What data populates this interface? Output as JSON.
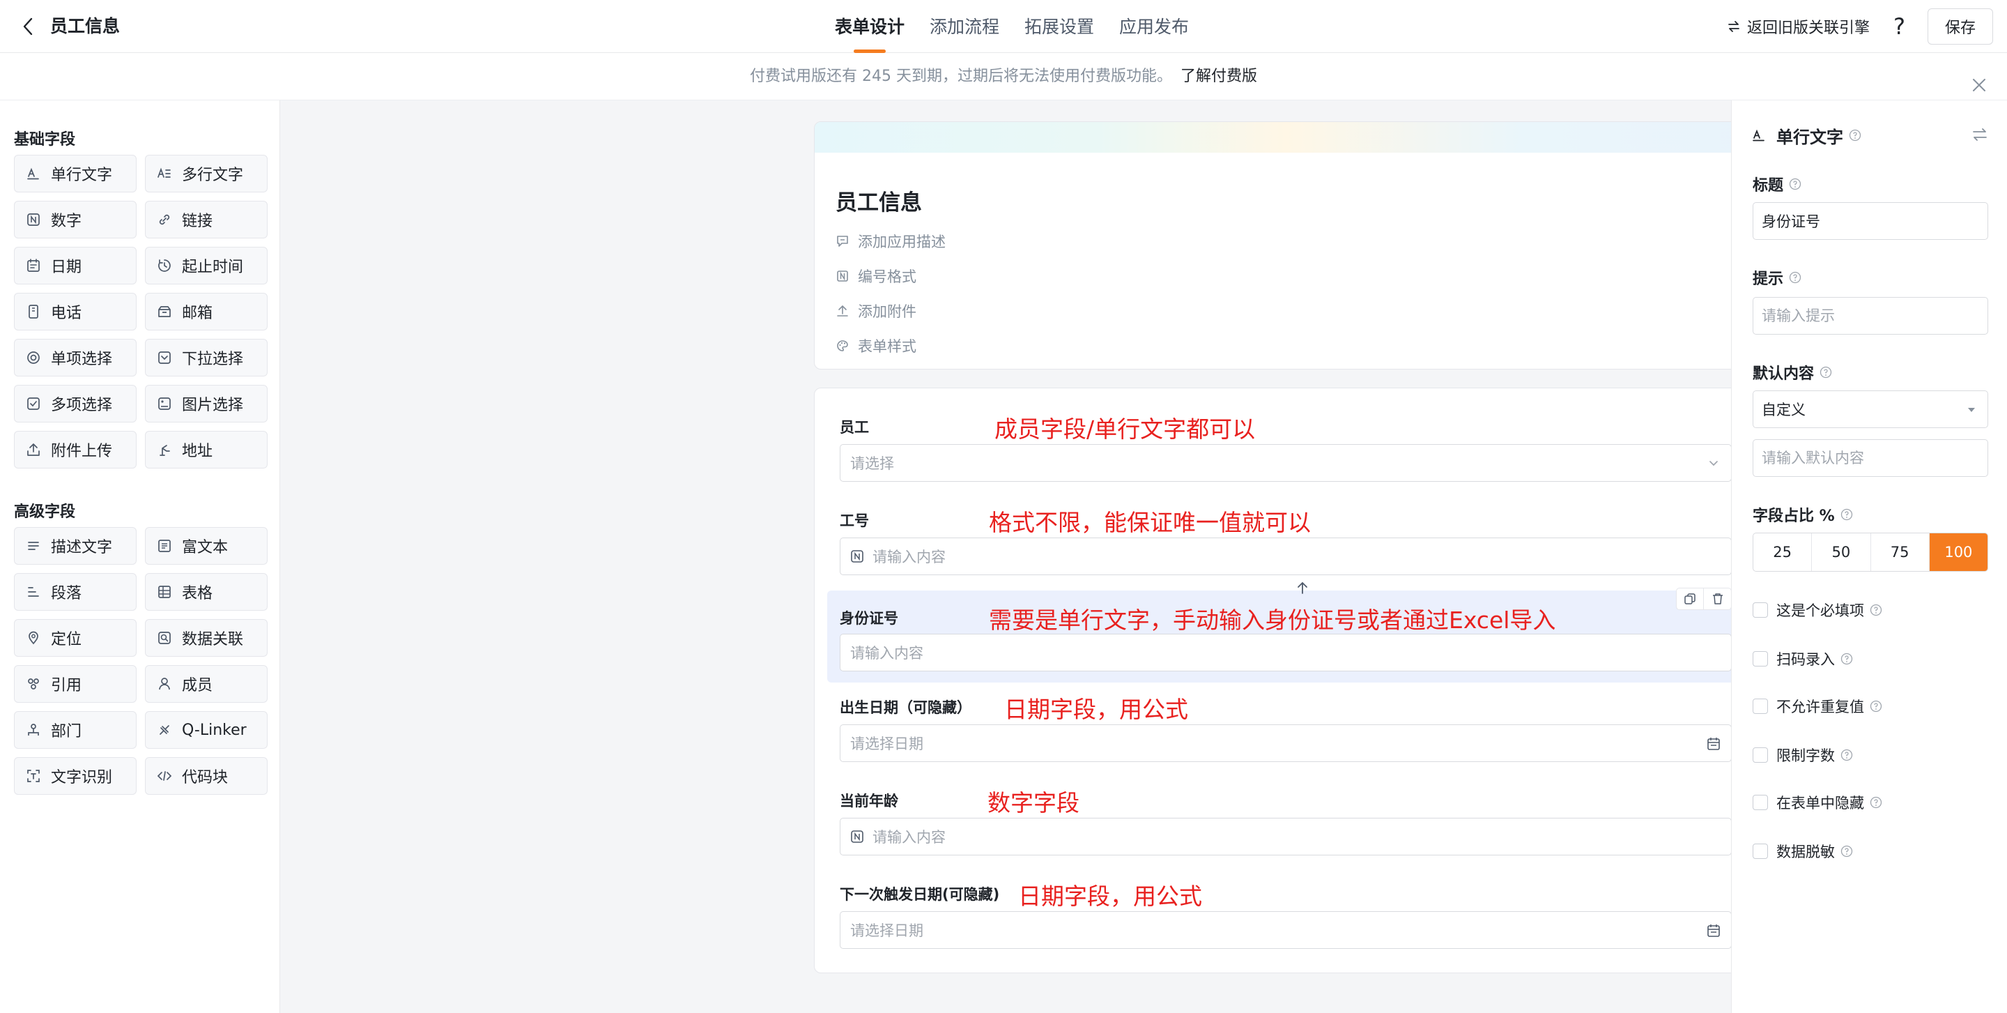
{
  "header": {
    "title": "员工信息",
    "tabs": [
      {
        "label": "表单设计",
        "active": true
      },
      {
        "label": "添加流程",
        "active": false
      },
      {
        "label": "拓展设置",
        "active": false
      },
      {
        "label": "应用发布",
        "active": false
      }
    ],
    "old_engine_link": "返回旧版关联引擎",
    "help": "?",
    "save_label": "保存"
  },
  "notice": {
    "text": "付费试用版还有 245 天到期，过期后将无法使用付费版功能。",
    "link": "了解付费版"
  },
  "sidebar": {
    "basic_title": "基础字段",
    "basic_fields": [
      {
        "label": "单行文字",
        "icon": "single-line-text-icon"
      },
      {
        "label": "多行文字",
        "icon": "multi-line-text-icon"
      },
      {
        "label": "数字",
        "icon": "number-icon"
      },
      {
        "label": "链接",
        "icon": "link-icon"
      },
      {
        "label": "日期",
        "icon": "date-icon"
      },
      {
        "label": "起止时间",
        "icon": "time-range-icon"
      },
      {
        "label": "电话",
        "icon": "phone-icon"
      },
      {
        "label": "邮箱",
        "icon": "mail-icon"
      },
      {
        "label": "单项选择",
        "icon": "radio-icon"
      },
      {
        "label": "下拉选择",
        "icon": "dropdown-icon"
      },
      {
        "label": "多项选择",
        "icon": "checkbox-icon"
      },
      {
        "label": "图片选择",
        "icon": "image-select-icon"
      },
      {
        "label": "附件上传",
        "icon": "upload-icon"
      },
      {
        "label": "地址",
        "icon": "address-icon"
      }
    ],
    "advanced_title": "高级字段",
    "advanced_fields": [
      {
        "label": "描述文字",
        "icon": "description-icon"
      },
      {
        "label": "富文本",
        "icon": "rich-text-icon"
      },
      {
        "label": "段落",
        "icon": "paragraph-icon"
      },
      {
        "label": "表格",
        "icon": "table-icon"
      },
      {
        "label": "定位",
        "icon": "location-icon"
      },
      {
        "label": "数据关联",
        "icon": "data-link-icon"
      },
      {
        "label": "引用",
        "icon": "reference-icon"
      },
      {
        "label": "成员",
        "icon": "member-icon"
      },
      {
        "label": "部门",
        "icon": "department-icon"
      },
      {
        "label": "Q-Linker",
        "icon": "q-linker-icon"
      },
      {
        "label": "文字识别",
        "icon": "ocr-icon"
      },
      {
        "label": "代码块",
        "icon": "code-icon"
      }
    ]
  },
  "form": {
    "title": "员工信息",
    "meta": [
      {
        "label": "添加应用描述",
        "icon": "description-icon"
      },
      {
        "label": "编号格式",
        "icon": "number-format-icon"
      },
      {
        "label": "添加附件",
        "icon": "attachment-icon"
      },
      {
        "label": "表单样式",
        "icon": "palette-icon"
      }
    ],
    "fields": [
      {
        "label": "员工",
        "placeholder": "请选择",
        "annotation": "成员字段/单行文字都可以",
        "kind": "select"
      },
      {
        "label": "工号",
        "placeholder": "请输入内容",
        "annotation": "格式不限，能保证唯一值就可以",
        "kind": "number"
      },
      {
        "label": "身份证号",
        "placeholder": "请输入内容",
        "annotation": "需要是单行文字，手动输入身份证号或者通过Excel导入",
        "kind": "text",
        "selected": true
      },
      {
        "label": "出生日期（可隐藏）",
        "placeholder": "请选择日期",
        "annotation": "日期字段，用公式",
        "kind": "date"
      },
      {
        "label": "当前年龄",
        "placeholder": "请输入内容",
        "annotation": "数字字段",
        "kind": "number"
      },
      {
        "label": "下一次触发日期(可隐藏)",
        "placeholder": "请选择日期",
        "annotation": "日期字段，用公式",
        "kind": "date"
      }
    ]
  },
  "props": {
    "type": "单行文字",
    "title_label": "标题",
    "title_value": "身份证号",
    "hint_label": "提示",
    "hint_placeholder": "请输入提示",
    "default_label": "默认内容",
    "default_mode": "自定义",
    "default_placeholder": "请输入默认内容",
    "width_label": "字段占比 %",
    "width_options": [
      "25",
      "50",
      "75",
      "100"
    ],
    "width_selected": "100",
    "options": [
      "这是个必填项",
      "扫码录入",
      "不允许重复值",
      "限制字数",
      "在表单中隐藏",
      "数据脱敏"
    ]
  },
  "colors": {
    "accent": "#f57c1f",
    "annotation": "#e8211f",
    "selected_bg": "#ebf0fd"
  }
}
